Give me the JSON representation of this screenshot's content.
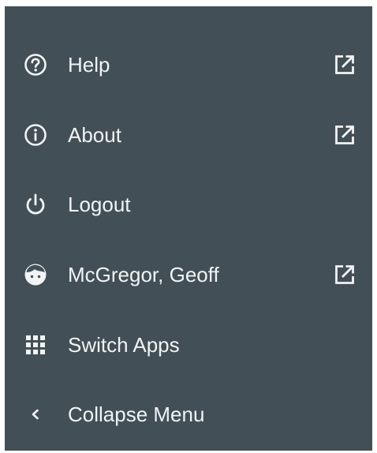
{
  "menu": {
    "background": "#434f57",
    "text_color": "#f1f3f4",
    "items": [
      {
        "label": "Help",
        "icon": "help-circle-icon",
        "external": true
      },
      {
        "label": "About",
        "icon": "info-circle-icon",
        "external": true
      },
      {
        "label": "Logout",
        "icon": "power-icon",
        "external": false
      },
      {
        "label": "McGregor, Geoff",
        "icon": "user-face-icon",
        "external": true
      },
      {
        "label": "Switch Apps",
        "icon": "apps-grid-icon",
        "external": false
      },
      {
        "label": "Collapse Menu",
        "icon": "chevron-left-icon",
        "external": false
      }
    ]
  }
}
